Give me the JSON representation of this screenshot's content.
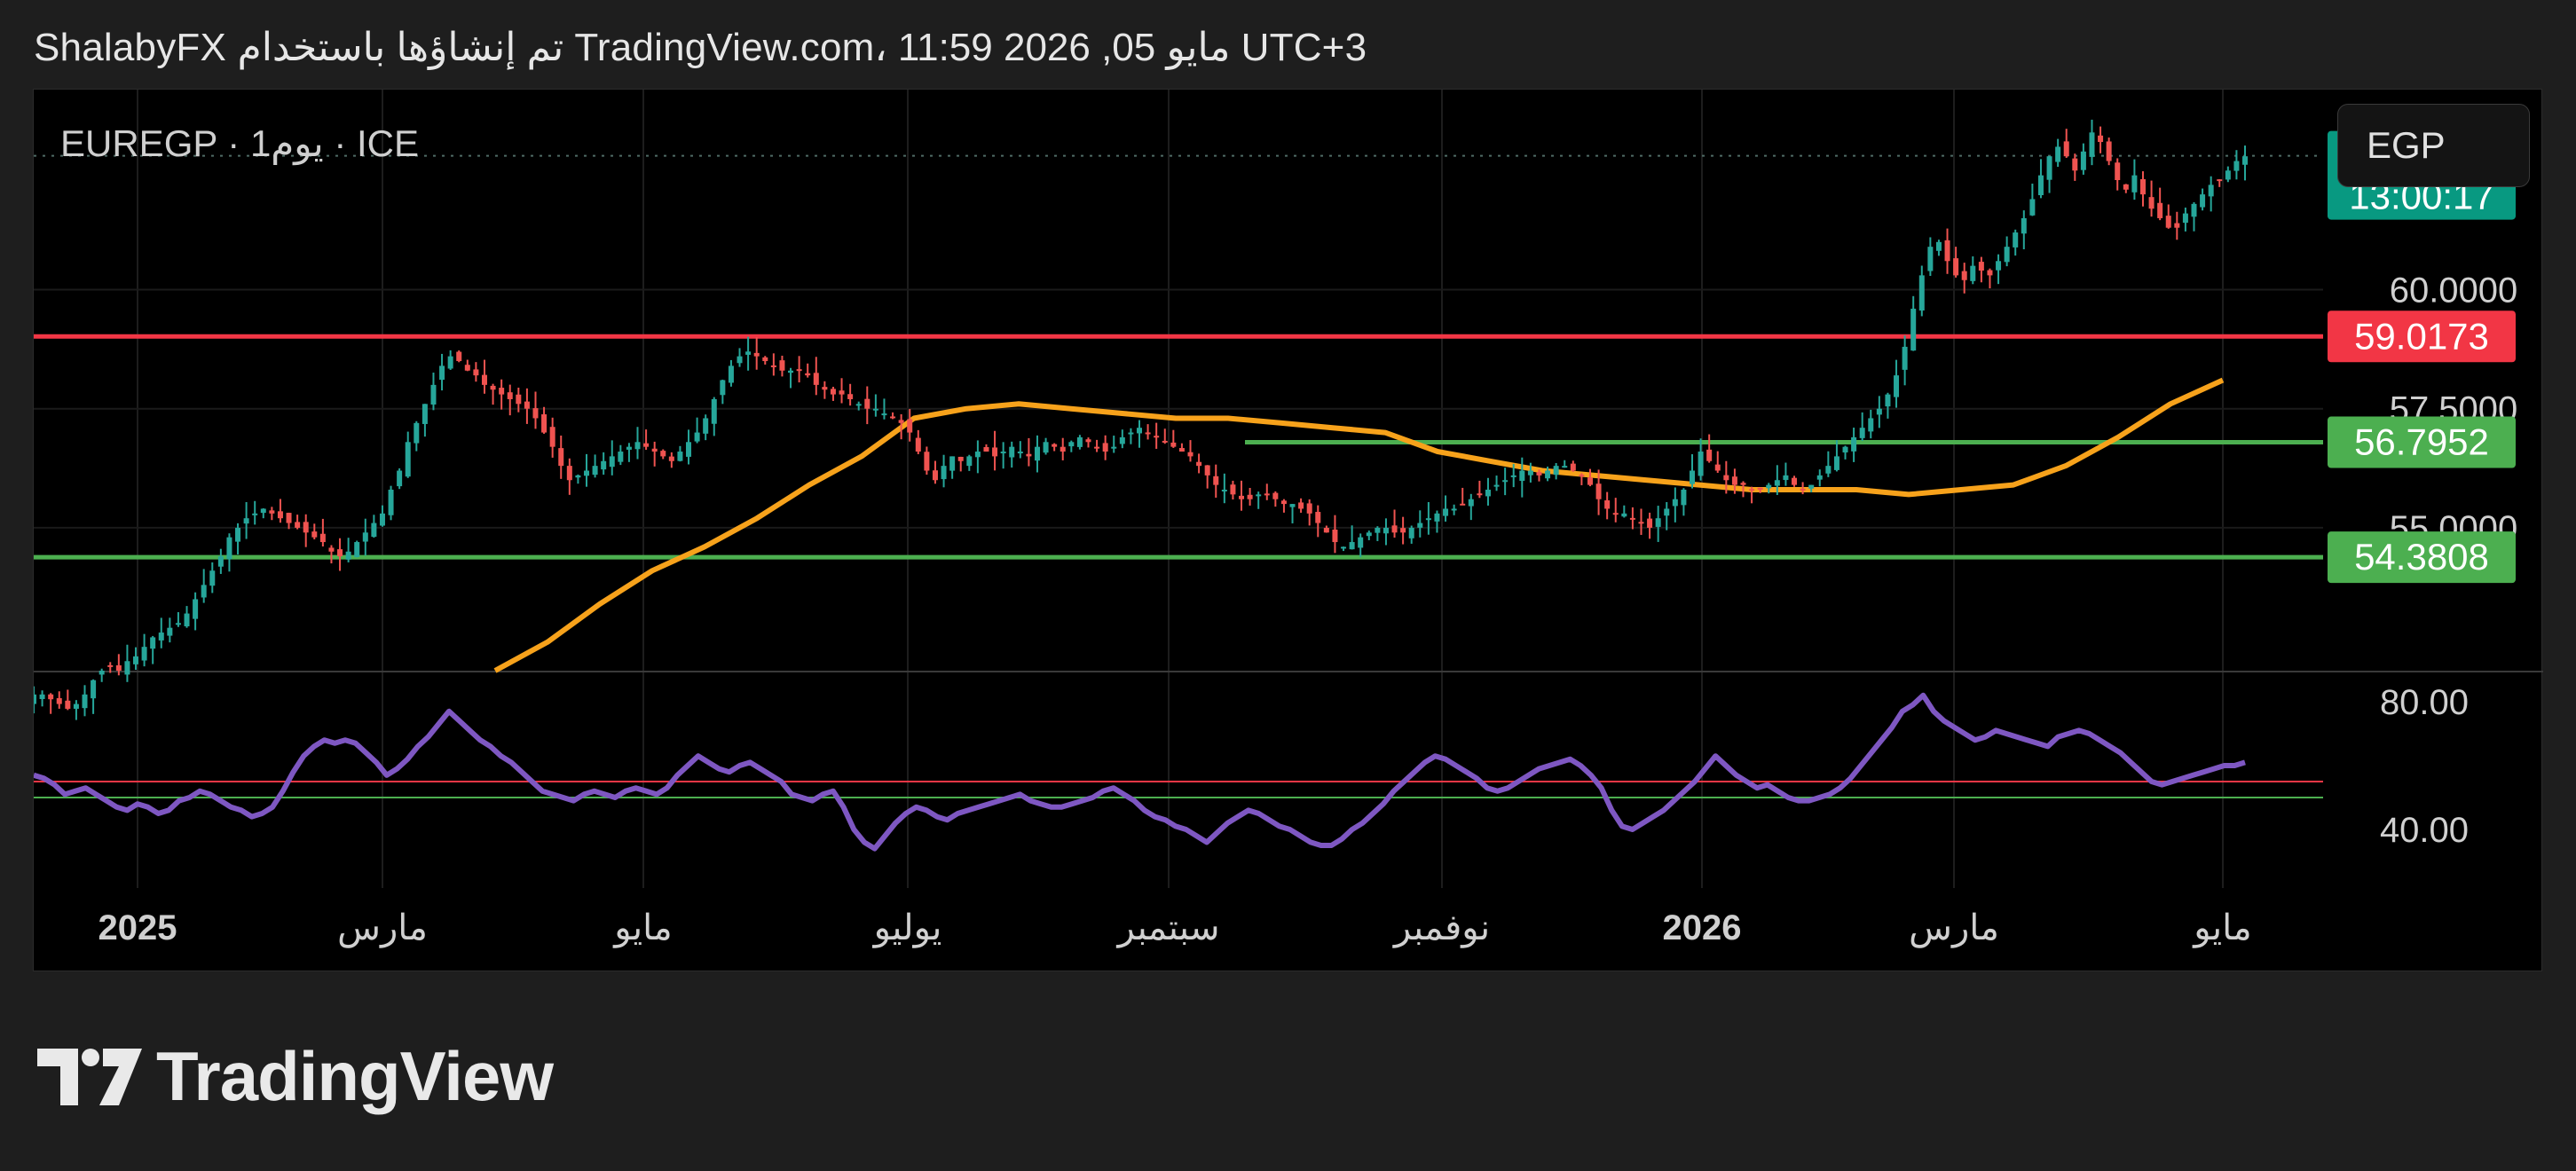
{
  "header": {
    "attribution": "ShalabyFX تم إنشاؤها باستخدام TradingView.com، 11:59 2026 ,05 مايو UTC+3"
  },
  "legend": {
    "symbol": "EUREGP · 1يوم · ICE"
  },
  "currency_button": "EGP",
  "brand": {
    "name": "TradingView"
  },
  "colors": {
    "background": "#000000",
    "candle_up": "#26a69a",
    "candle_down": "#ef5350",
    "moving_average": "#f7a21b",
    "rsi_line": "#7e57c2",
    "resistance_line": "#f23645",
    "support_line": "#4caf50",
    "last_price_badge": "#089981"
  },
  "chart_data": {
    "type": "candlestick",
    "symbol": "EUREGP",
    "interval": "1D",
    "exchange": "ICE",
    "price_axis": {
      "labels": [
        "60.0000",
        "57.5000",
        "55.0000"
      ],
      "range": [
        52.0,
        64.2
      ]
    },
    "time_axis": {
      "labels": [
        "2025",
        "مارس",
        "مايو",
        "يوليو",
        "سبتمبر",
        "نوفمبر",
        "2026",
        "مارس",
        "مايو"
      ]
    },
    "last_price": {
      "value": "62.8110",
      "countdown": "13:00:17"
    },
    "horizontal_lines": [
      {
        "value": 59.0173,
        "label": "59.0173",
        "color": "#f23645"
      },
      {
        "value": 56.7952,
        "label": "56.7952",
        "color": "#4caf50"
      },
      {
        "value": 54.3808,
        "label": "54.3808",
        "color": "#4caf50"
      }
    ],
    "candles_closes": [
      51.5,
      51.5,
      51.4,
      51.3,
      51.2,
      51.3,
      51.5,
      51.8,
      52.0,
      52.1,
      52.0,
      52.2,
      52.3,
      52.5,
      52.7,
      52.8,
      52.9,
      53.0,
      53.2,
      53.5,
      53.8,
      54.1,
      54.4,
      54.8,
      55.0,
      55.2,
      55.3,
      55.4,
      55.3,
      55.2,
      55.1,
      55.0,
      54.9,
      54.8,
      54.7,
      54.5,
      54.4,
      54.5,
      54.7,
      54.9,
      55.1,
      55.3,
      55.8,
      56.2,
      56.8,
      57.2,
      57.6,
      58.0,
      58.4,
      58.6,
      58.5,
      58.3,
      58.2,
      58.0,
      57.9,
      57.8,
      57.7,
      57.6,
      57.5,
      57.3,
      57.0,
      56.7,
      56.3,
      56.0,
      56.1,
      56.2,
      56.3,
      56.4,
      56.5,
      56.6,
      56.7,
      56.8,
      56.7,
      56.6,
      56.5,
      56.4,
      56.6,
      56.8,
      57.0,
      57.3,
      57.7,
      58.1,
      58.4,
      58.6,
      58.7,
      58.6,
      58.5,
      58.4,
      58.3,
      58.3,
      58.3,
      58.2,
      58.0,
      57.9,
      57.8,
      57.8,
      57.7,
      57.6,
      57.5,
      57.5,
      57.4,
      57.3,
      57.2,
      57.0,
      56.6,
      56.2,
      56.0,
      56.3,
      56.5,
      56.4,
      56.5,
      56.6,
      56.6,
      56.5,
      56.6,
      56.7,
      56.6,
      56.5,
      56.7,
      56.8,
      56.7,
      56.6,
      56.8,
      56.9,
      56.8,
      56.7,
      56.6,
      56.7,
      56.9,
      57.0,
      57.1,
      57.0,
      56.9,
      56.8,
      56.7,
      56.6,
      56.5,
      56.3,
      56.1,
      55.9,
      55.8,
      55.7,
      55.6,
      55.6,
      55.7,
      55.7,
      55.6,
      55.5,
      55.5,
      55.4,
      55.3,
      55.1,
      54.9,
      54.7,
      54.6,
      54.7,
      54.8,
      54.9,
      55.0,
      55.0,
      54.9,
      54.9,
      55.0,
      55.1,
      55.2,
      55.3,
      55.4,
      55.4,
      55.5,
      55.6,
      55.7,
      55.8,
      55.9,
      56.0,
      56.1,
      56.2,
      56.2,
      56.1,
      56.2,
      56.3,
      56.3,
      56.2,
      56.1,
      55.9,
      55.6,
      55.4,
      55.3,
      55.3,
      55.2,
      55.1,
      55.0,
      55.2,
      55.4,
      55.6,
      55.8,
      56.2,
      56.6,
      56.4,
      56.2,
      56.0,
      55.9,
      55.9,
      55.8,
      55.8,
      55.9,
      56.0,
      56.1,
      55.9,
      55.8,
      55.9,
      56.1,
      56.3,
      56.5,
      56.7,
      56.9,
      57.1,
      57.3,
      57.5,
      57.8,
      58.2,
      58.8,
      59.6,
      60.3,
      60.9,
      61.0,
      60.6,
      60.3,
      60.2,
      60.5,
      60.4,
      60.3,
      60.6,
      60.9,
      61.2,
      61.5,
      61.9,
      62.4,
      62.8,
      63.0,
      62.8,
      62.5,
      62.9,
      63.3,
      63.1,
      62.7,
      62.3,
      62.1,
      62.4,
      62.0,
      61.7,
      61.5,
      61.3,
      61.3,
      61.6,
      61.8,
      62.0,
      62.2,
      62.3,
      62.5,
      62.7,
      62.8
    ],
    "moving_average": {
      "start_date": "2025-01-07",
      "end_date": "2026-05-05",
      "values": [
        52.0,
        52.6,
        53.4,
        54.1,
        54.6,
        55.2,
        55.9,
        56.5,
        57.3,
        57.5,
        57.6,
        57.5,
        57.4,
        57.3,
        57.3,
        57.2,
        57.1,
        57.0,
        56.6,
        56.4,
        56.2,
        56.1,
        56.0,
        55.9,
        55.8,
        55.8,
        55.8,
        55.7,
        55.8,
        55.9,
        56.3,
        56.9,
        57.6,
        58.1
      ]
    },
    "rsi": {
      "axis_labels": [
        "80.00",
        "40.00"
      ],
      "levels": [
        55,
        50
      ],
      "values": [
        57,
        56,
        54,
        51,
        52,
        53,
        51,
        49,
        47,
        46,
        48,
        47,
        45,
        46,
        49,
        50,
        52,
        51,
        49,
        47,
        46,
        44,
        45,
        47,
        52,
        58,
        63,
        66,
        68,
        67,
        68,
        67,
        64,
        61,
        57,
        59,
        62,
        66,
        69,
        73,
        77,
        74,
        71,
        68,
        66,
        63,
        61,
        58,
        55,
        52,
        51,
        50,
        49,
        51,
        52,
        51,
        50,
        52,
        53,
        52,
        51,
        53,
        57,
        60,
        63,
        61,
        59,
        58,
        60,
        61,
        59,
        57,
        55,
        51,
        50,
        49,
        51,
        52,
        47,
        40,
        36,
        34,
        38,
        42,
        45,
        47,
        46,
        44,
        43,
        45,
        46,
        47,
        48,
        49,
        50,
        51,
        49,
        48,
        47,
        47,
        48,
        49,
        50,
        52,
        53,
        51,
        49,
        46,
        44,
        43,
        41,
        40,
        38,
        36,
        39,
        42,
        44,
        46,
        45,
        43,
        41,
        40,
        38,
        36,
        35,
        35,
        37,
        40,
        42,
        45,
        48,
        52,
        55,
        58,
        61,
        63,
        62,
        60,
        58,
        56,
        53,
        52,
        53,
        55,
        57,
        59,
        60,
        61,
        62,
        60,
        57,
        53,
        46,
        41,
        40,
        42,
        44,
        46,
        49,
        52,
        55,
        59,
        63,
        60,
        57,
        55,
        53,
        54,
        52,
        50,
        49,
        49,
        50,
        51,
        53,
        56,
        60,
        64,
        68,
        72,
        77,
        79,
        82,
        77,
        74,
        72,
        70,
        68,
        69,
        71,
        70,
        69,
        68,
        67,
        66,
        69,
        70,
        71,
        70,
        68,
        66,
        64,
        61,
        58,
        55,
        54,
        55,
        56,
        57,
        58,
        59,
        60,
        60,
        61
      ]
    }
  }
}
